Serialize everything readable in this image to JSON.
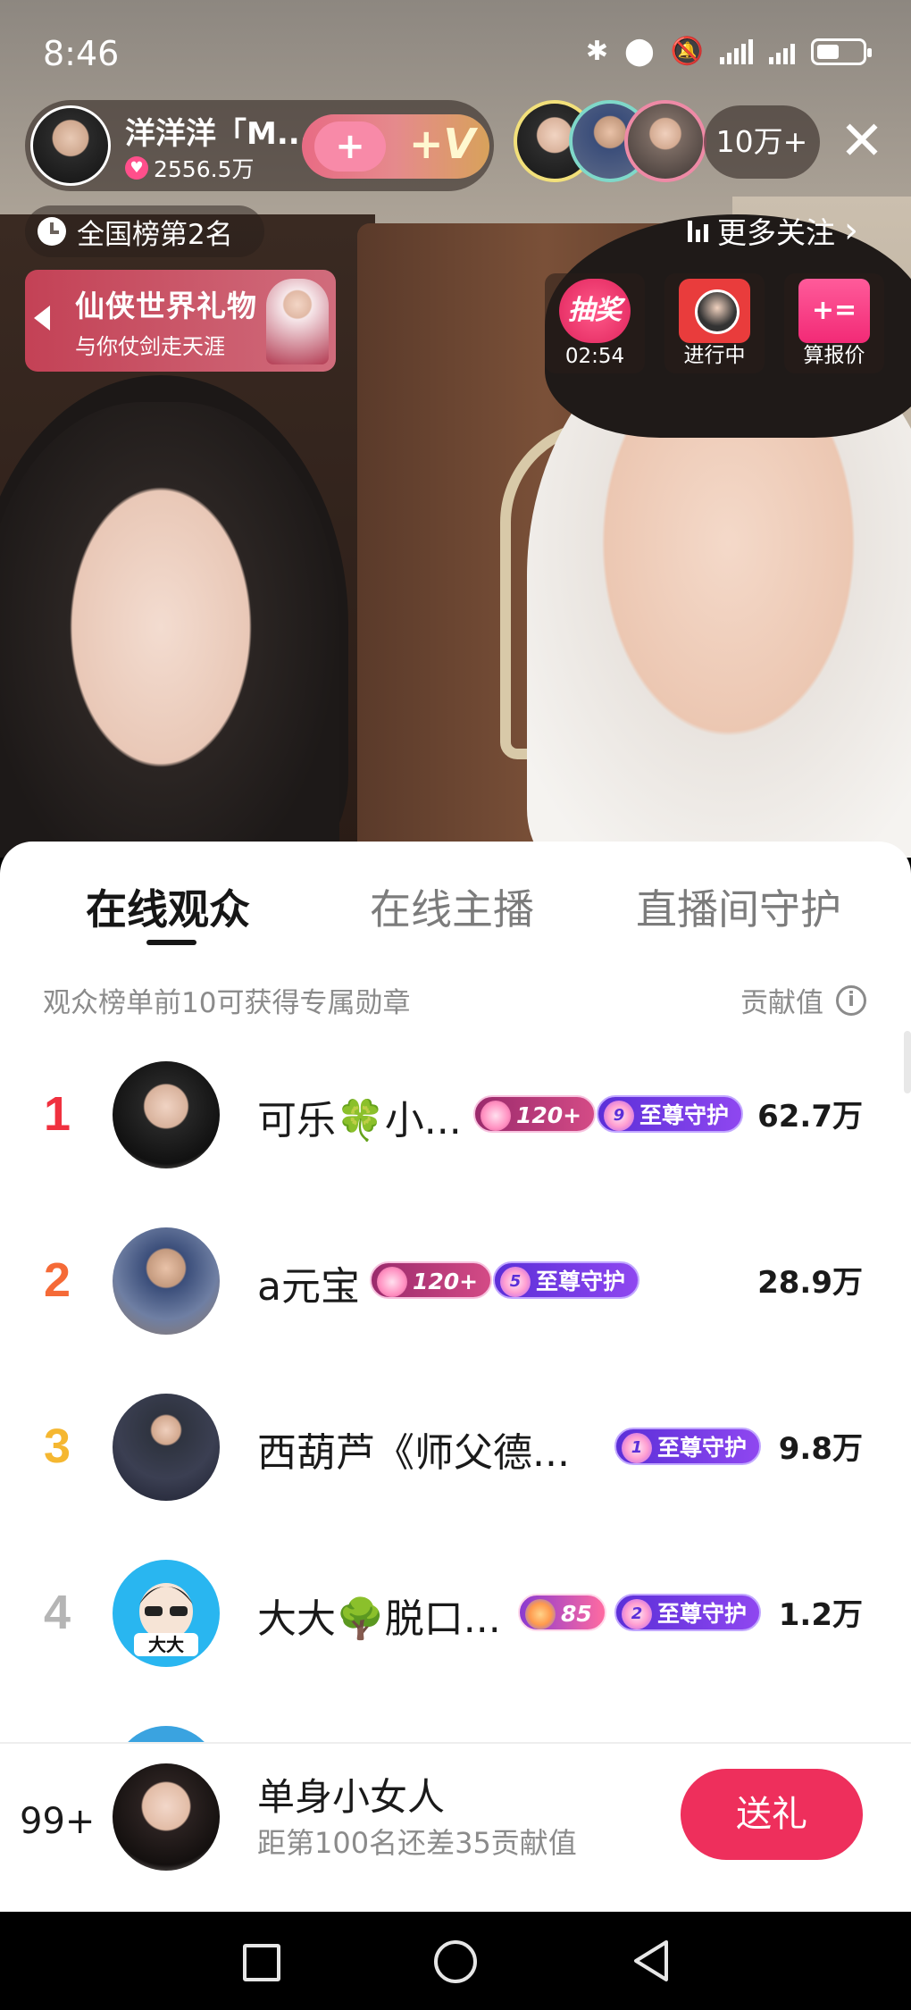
{
  "status_bar": {
    "time": "8:46"
  },
  "live_header": {
    "host_name": "洋洋洋「M...",
    "host_likes": "2556.5万",
    "follow_heart": "+",
    "follow_v": "+V",
    "viewer_count": "10万+",
    "close": "✕",
    "rank_label": "全国榜第2名",
    "more_follow_label": "更多关注",
    "more_follow_chevron": "›"
  },
  "banner": {
    "title": "仙侠世界礼物",
    "subtitle": "与你仗剑走天涯"
  },
  "activities": [
    {
      "icon_text": "抽奖",
      "label": "02:54"
    },
    {
      "icon_text": "",
      "label": "进行中"
    },
    {
      "icon_text": "+=",
      "label": "算报价"
    }
  ],
  "sheet": {
    "tabs": [
      "在线观众",
      "在线主播",
      "直播间守护"
    ],
    "active_tab": 0,
    "hint": "观众榜单前10可获得专属勋章",
    "contribution_label": "贡献值",
    "info_icon": "i"
  },
  "leaderboard": [
    {
      "rank": "1",
      "name": "可乐🍀小...",
      "level": "120+",
      "guard_num": "9",
      "guard": "至尊守护",
      "score": "62.7万",
      "rank_color": "#f0313f"
    },
    {
      "rank": "2",
      "name": "a元宝",
      "level": "120+",
      "guard_num": "5",
      "guard": "至尊守护",
      "score": "28.9万",
      "rank_color": "#f56a37"
    },
    {
      "rank": "3",
      "name": "西葫芦《师父德...",
      "level": "",
      "guard_num": "1",
      "guard": "至尊守护",
      "score": "9.8万",
      "rank_color": "#f5b731"
    },
    {
      "rank": "4",
      "name": "大大🌳脱口...",
      "level": "85",
      "guard_num": "2",
      "guard": "至尊守护",
      "score": "1.2万",
      "rank_color": "#b5b5b5"
    }
  ],
  "me": {
    "rank": "99+",
    "name": "单身小女人",
    "sub": "距第100名还差35贡献值",
    "gift_button": "送礼"
  }
}
